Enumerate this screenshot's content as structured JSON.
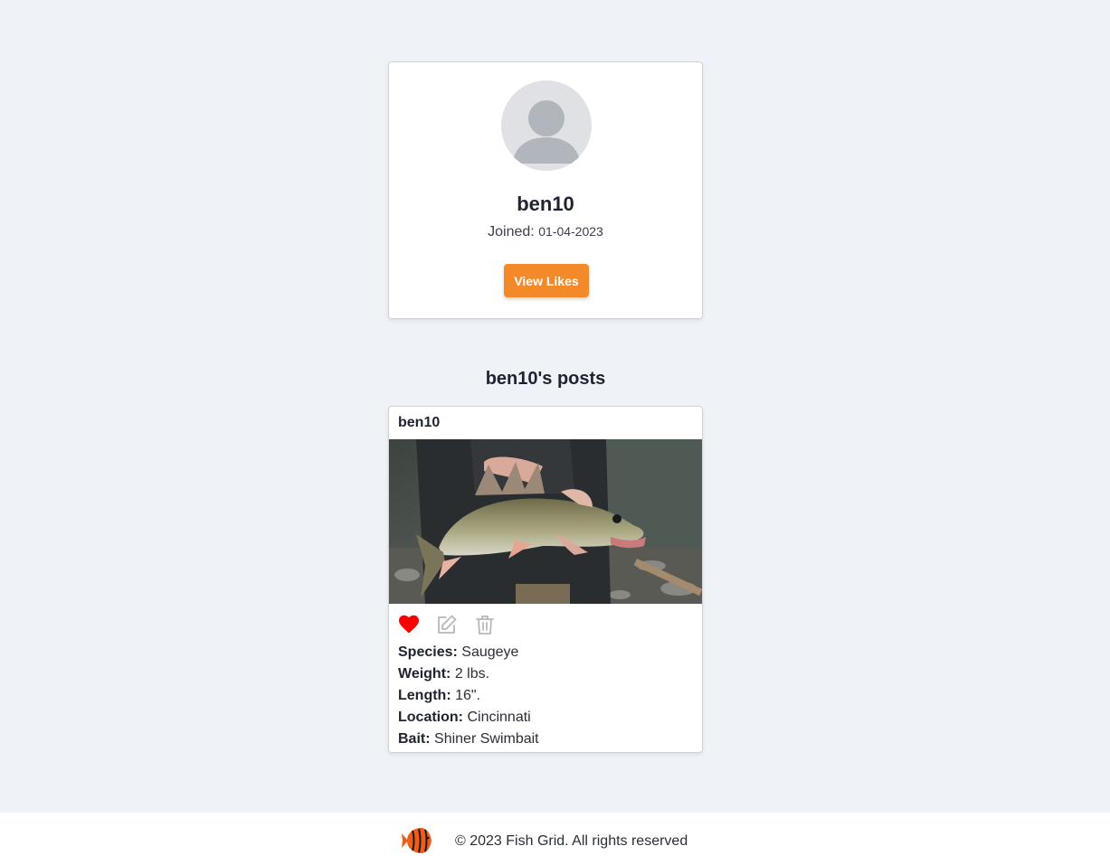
{
  "profile": {
    "username": "ben10",
    "joined_label": "Joined:",
    "joined_date": "01-04-2023",
    "view_likes_label": "View Likes"
  },
  "posts_section": {
    "heading": "ben10's posts"
  },
  "posts": [
    {
      "author": "ben10",
      "liked": true,
      "species_label": "Species:",
      "species": "Saugeye",
      "weight_label": "Weight:",
      "weight": "2 lbs.",
      "length_label": "Length:",
      "length": "16\".",
      "location_label": "Location:",
      "location": "Cincinnati",
      "bait_label": "Bait:",
      "bait": "Shiner Swimbait"
    }
  ],
  "footer": {
    "copyright": "© 2023 Fish Grid. All rights reserved"
  },
  "colors": {
    "background": "#eff2f6",
    "accent": "#f4892a",
    "like": "#ff0000",
    "icon_muted": "#b8b8b8",
    "logo": "#f25c19"
  },
  "icons": {
    "avatar": "user-silhouette-icon",
    "like": "heart-icon",
    "edit": "edit-icon",
    "delete": "trash-icon",
    "logo": "fish-logo-icon"
  }
}
